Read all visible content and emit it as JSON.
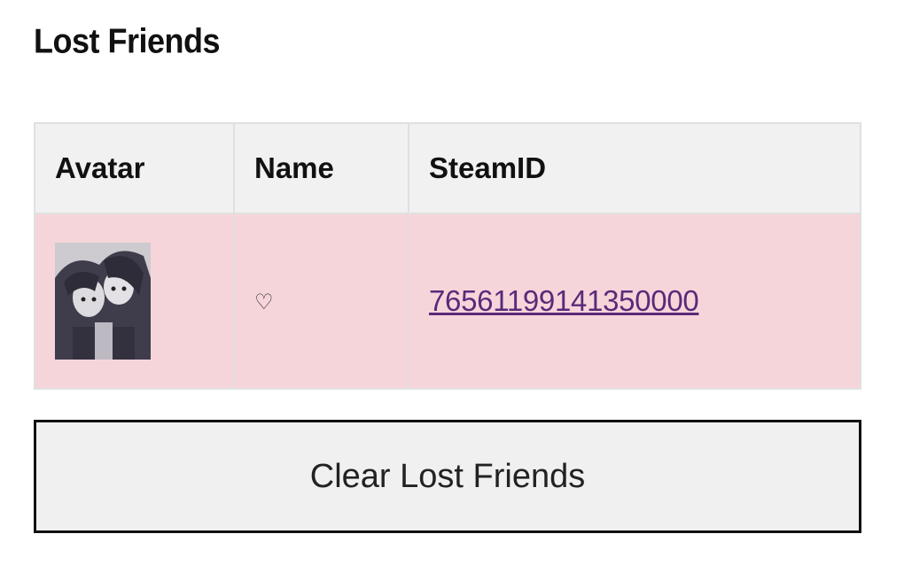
{
  "page": {
    "title": "Lost Friends"
  },
  "table": {
    "headers": {
      "avatar": "Avatar",
      "name": "Name",
      "steamid": "SteamID"
    },
    "rows": [
      {
        "avatar_alt": "friend avatar",
        "name": "♡",
        "steamid": "76561199141350000"
      }
    ]
  },
  "actions": {
    "clear_label": "Clear Lost Friends"
  },
  "colors": {
    "header_bg": "#f1f1f1",
    "row_bg": "#f6d5da",
    "link": "#5a2a7a"
  }
}
